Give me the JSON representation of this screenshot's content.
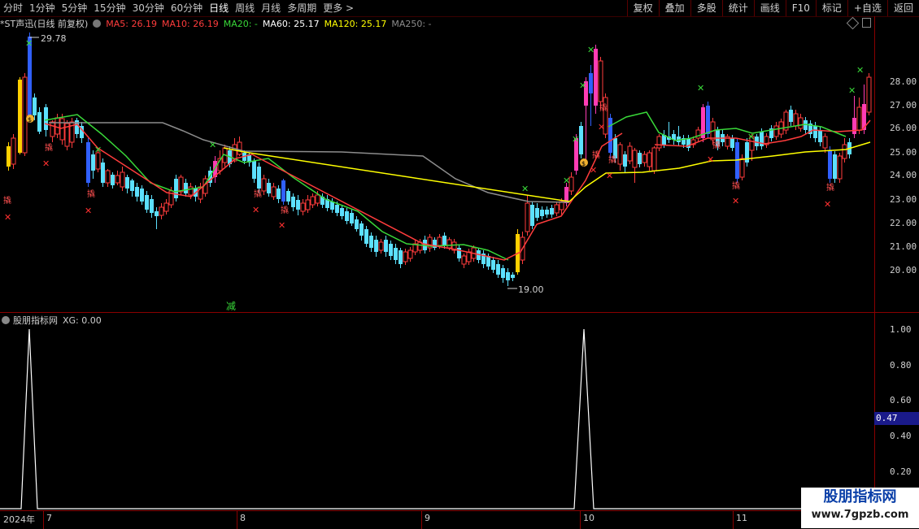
{
  "toolbar": {
    "tabs": [
      "分时",
      "1分钟",
      "5分钟",
      "15分钟",
      "30分钟",
      "60分钟",
      "日线",
      "周线",
      "月线",
      "多周期",
      "更多 >"
    ],
    "active_tab": "日线",
    "buttons": [
      "复权",
      "叠加",
      "多股",
      "统计",
      "画线",
      "F10",
      "标记",
      "+自选",
      "返回"
    ]
  },
  "header": {
    "stock": "*ST声迅(日线 前复权)",
    "ma5": "MA5: 26.19",
    "ma10": "MA10: 26.19",
    "ma20": "MA20: -",
    "ma60": "MA60: 25.17",
    "ma120": "MA120: 25.17",
    "ma250": "MA250: -",
    "colors": {
      "ma5": "#ff3c3c",
      "ma10": "#ff3c3c",
      "ma20": "#39d839",
      "ma60": "#ffffff",
      "ma120": "#ffff00",
      "ma250": "#8c8c8c"
    }
  },
  "price_axis": {
    "labels": [
      "28.00",
      "27.00",
      "26.00",
      "25.00",
      "24.00",
      "23.00",
      "22.00",
      "21.00",
      "20.00"
    ]
  },
  "annotations": {
    "high": "29.78",
    "low": "19.00",
    "reduce_mark": "减",
    "sell_glyph": "✕",
    "buy_label": "炸",
    "label_fly": "撬",
    "coin": "$"
  },
  "indicator": {
    "title": "股朋指标网",
    "xg": "XG: 0.00",
    "axis_labels": [
      "1.00",
      "0.80",
      "0.60",
      "0.40",
      "0.20"
    ],
    "current_value": "0.47"
  },
  "dates": {
    "year": "2024年",
    "months": [
      "7",
      "8",
      "9",
      "10",
      "11"
    ]
  },
  "watermark": {
    "line1": "股朋指标网",
    "line2": "www.7gpzb.com"
  },
  "chart_data": {
    "type": "candlestick",
    "ylim": [
      19.0,
      30.0
    ],
    "high": 29.78,
    "low": 19.0,
    "indicator_signal": {
      "ylim": [
        0,
        1.05
      ],
      "peaks": [
        1.0,
        1.0
      ]
    }
  }
}
